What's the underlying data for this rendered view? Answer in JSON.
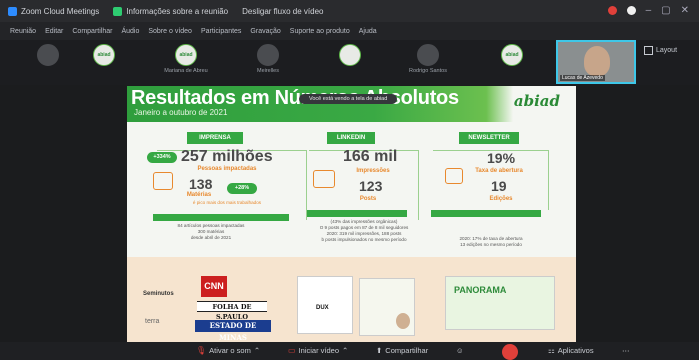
{
  "titlebar": {
    "app": "Zoom Cloud Meetings",
    "info": "Informações sobre a reunião",
    "view": "Desligar fluxo de vídeo"
  },
  "menu": [
    "Reunião",
    "Editar",
    "Compartilhar",
    "Áudio",
    "Sobre o vídeo",
    "Participantes",
    "Gravação",
    "Suporte ao produto",
    "Ajuda"
  ],
  "gallery": [
    {
      "name": "",
      "logo": "abiad"
    },
    {
      "name": "Mariana de Abreu",
      "logo": "abiad"
    },
    {
      "name": "Meirelles",
      "logo": ""
    },
    {
      "name": "Rodrigo Santos",
      "logo": "abiad"
    },
    {
      "name": "",
      "logo": "abiad"
    }
  ],
  "self_view_name": "Lucas de Azevedo",
  "layout_label": "Layout",
  "share_banner": "Você está vendo a tela de abiad",
  "slide": {
    "title": "Resultados em Números Absolutos",
    "subtitle": "Janeiro a outubro de 2021",
    "brand": "abiad",
    "cols": [
      {
        "head": "IMPRENSA",
        "big": "257 milhões",
        "badge": "+334%",
        "label1": "Pessoas impactadas",
        "mid": "138",
        "badge2": "+28%",
        "label2": "Matérias",
        "note": "é pico mais dos mais trabalhados",
        "foot": "84 artículos pessoas impactadas\n300 matérias\ndesde abril de 2021"
      },
      {
        "head": "LINKEDIN",
        "big": "166 mil",
        "label1": "Impressões",
        "mid": "123",
        "label2": "Posts",
        "foot": "(43% das impressões orgânicas)\nO 9 posts pagos em 87 de 8 mil seguidores\n2020: 319 mil impressões, 188 posts\nb posts impulsionados no mesmo período"
      },
      {
        "head": "NEWSLETTER",
        "big": "19%",
        "label1": "Taxa de abertura",
        "mid": "19",
        "label2": "Edições",
        "foot": "2020: 17% de taxa de abertura\n13 edições no mesmo período"
      }
    ],
    "media": {
      "cnn": "CNN",
      "folha": "FOLHA DE S.PAULO",
      "estado": "ESTADO DE MINAS",
      "minutos": "Seminutos",
      "terra": "terra",
      "dux": "DUX",
      "panorama": "PANORAMA"
    }
  },
  "toolbar": {
    "audio": "Ativar o som",
    "video": "Iniciar vídeo",
    "share": "Compartilhar",
    "apps": "Aplicativos"
  }
}
